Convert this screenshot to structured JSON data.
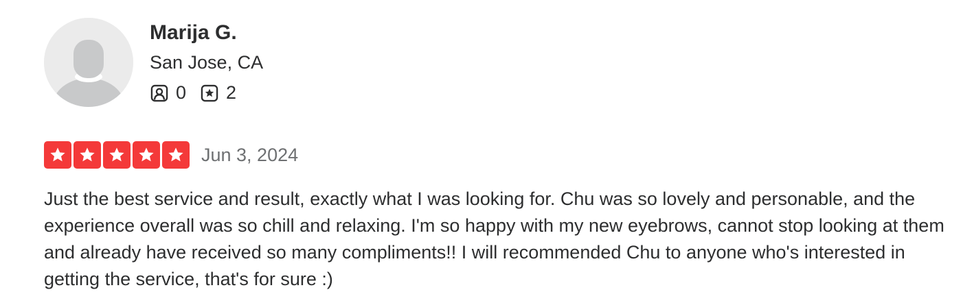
{
  "user": {
    "name": "Marija G.",
    "location": "San Jose, CA",
    "friends_count": "0",
    "reviews_count": "2",
    "avatar_icon": "default-avatar-icon"
  },
  "review": {
    "rating": 5,
    "rating_max": 5,
    "date": "Jun 3, 2024",
    "text": "Just the best service and result, exactly what I was looking for. Chu was so lovely and personable, and the experience overall was so chill and relaxing. I'm so happy with my new eyebrows, cannot stop looking at them and already have received so many compliments!! I will recommended Chu to anyone who's interested in getting the service, that's for sure :)"
  },
  "colors": {
    "star": "#f43939",
    "text": "#2d2e2f",
    "muted": "#6e7072",
    "avatar_bg": "#ebebeb"
  }
}
